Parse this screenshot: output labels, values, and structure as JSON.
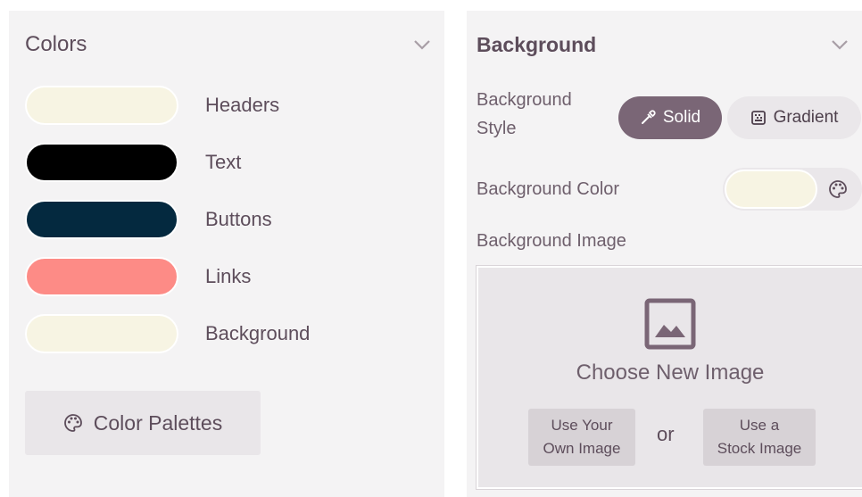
{
  "colors_panel": {
    "title": "Colors",
    "items": [
      {
        "label": "Headers",
        "color": "#f7f4e3"
      },
      {
        "label": "Text",
        "color": "#000000"
      },
      {
        "label": "Buttons",
        "color": "#04293f"
      },
      {
        "label": "Links",
        "color": "#fd8b86"
      },
      {
        "label": "Background",
        "color": "#f7f4e3"
      }
    ],
    "palettes_button": "Color Palettes"
  },
  "background_panel": {
    "title": "Background",
    "style_label": "Background\nStyle",
    "style_options": {
      "solid": "Solid",
      "gradient": "Gradient",
      "selected": "Solid"
    },
    "color_label": "Background Color",
    "color_value": "#f7f4e3",
    "image_label": "Background Image",
    "image_box": {
      "title": "Choose New Image",
      "own_button": "Use Your\nOwn Image",
      "or": "or",
      "stock_button": "Use a\nStock Image"
    }
  },
  "icons": {
    "chevron": "chevron-down-icon",
    "palette": "palette-icon",
    "eyedropper": "eyedropper-icon",
    "gradient": "gradient-icon",
    "image": "image-icon"
  },
  "accent": "#7a6676"
}
